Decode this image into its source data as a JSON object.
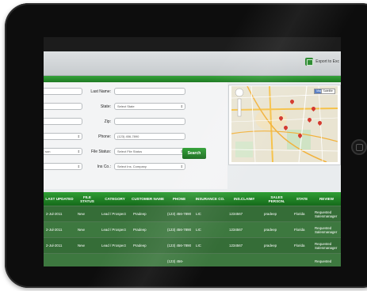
{
  "toolbar": {
    "export_label": "Export to Exc"
  },
  "form": {
    "last_name_label": "Last Name:",
    "state_label": "State:",
    "state_value": "Select State",
    "zip_label": "Zip:",
    "phone_label": "Phone:",
    "phone_value": "(123) 456-7890",
    "file_status_label": "File Status:",
    "file_status_value": "Select File Status",
    "ins_co_label": "Ins Co.:",
    "ins_co_value": "Select Ins. Company",
    "left_partial_select_1": "son",
    "search_label": "Search"
  },
  "map": {
    "type_map_label": "Map",
    "type_satellite_label": "Satellite"
  },
  "table": {
    "headers": [
      "LAST UPDATED",
      "FILE STATUS",
      "CATEGORY",
      "CUSTOMER NAME",
      "PHONE",
      "INSURANCE CO.",
      "INS.CLAIM#",
      "SALES PERSON.",
      "STATE",
      "REVIEW"
    ],
    "rows": [
      [
        "2-Jul-2011",
        "New",
        "Lead / Prospect",
        "Pradeep",
        "(123) 456-7890",
        "LIC",
        "1234567",
        "pradeep",
        "Florida",
        "Requested Salesmanager"
      ],
      [
        "2-Jul-2011",
        "New",
        "Lead / Prospect",
        "Pradeep",
        "(123) 456-7890",
        "LIC",
        "1234567",
        "pradeep",
        "Florida",
        "Requested Salesmanager"
      ],
      [
        "2-Jul-2011",
        "New",
        "Lead / Prospect",
        "Pradeep",
        "(123) 456-7890",
        "LIC",
        "1234567",
        "pradeep",
        "Florida",
        "Requested Salesmanager"
      ],
      [
        "",
        "",
        "",
        "",
        "(123) 456-",
        "",
        "",
        "",
        "",
        "Requested"
      ]
    ]
  },
  "colors": {
    "accent_green": "#1e7a22",
    "row_green": "#356d37"
  }
}
